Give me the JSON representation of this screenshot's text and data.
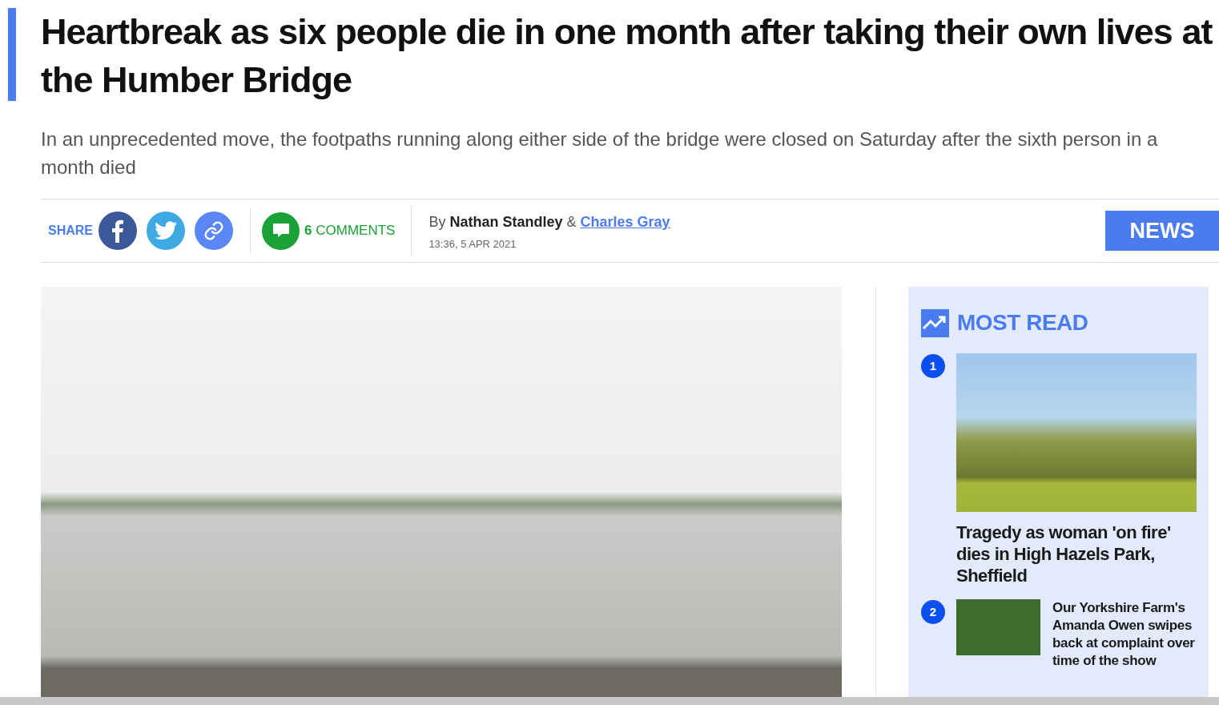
{
  "headline": "Heartbreak as six people die in one month after taking their own lives at the Humber Bridge",
  "standfirst": "In an unprecedented move, the footpaths running along either side of the bridge were closed on Saturday after the sixth person in a month died",
  "share": {
    "label": "SHARE"
  },
  "comments": {
    "count": "6",
    "label": "COMMENTS"
  },
  "byline": {
    "prefix": "By",
    "author": "Nathan Standley",
    "joiner": "&",
    "coauthor": "Charles Gray",
    "timestamp": "13:36, 5 APR 2021"
  },
  "section_tag": "NEWS",
  "most_read": {
    "title": "MOST READ",
    "items": [
      {
        "rank": "1",
        "headline": "Tragedy as woman 'on fire' dies in High Hazels Park, Sheffield",
        "kind": "large"
      },
      {
        "rank": "2",
        "headline": "Our Yorkshire Farm's Amanda Owen swipes back at complaint over time of the show",
        "kind": "small"
      }
    ]
  }
}
